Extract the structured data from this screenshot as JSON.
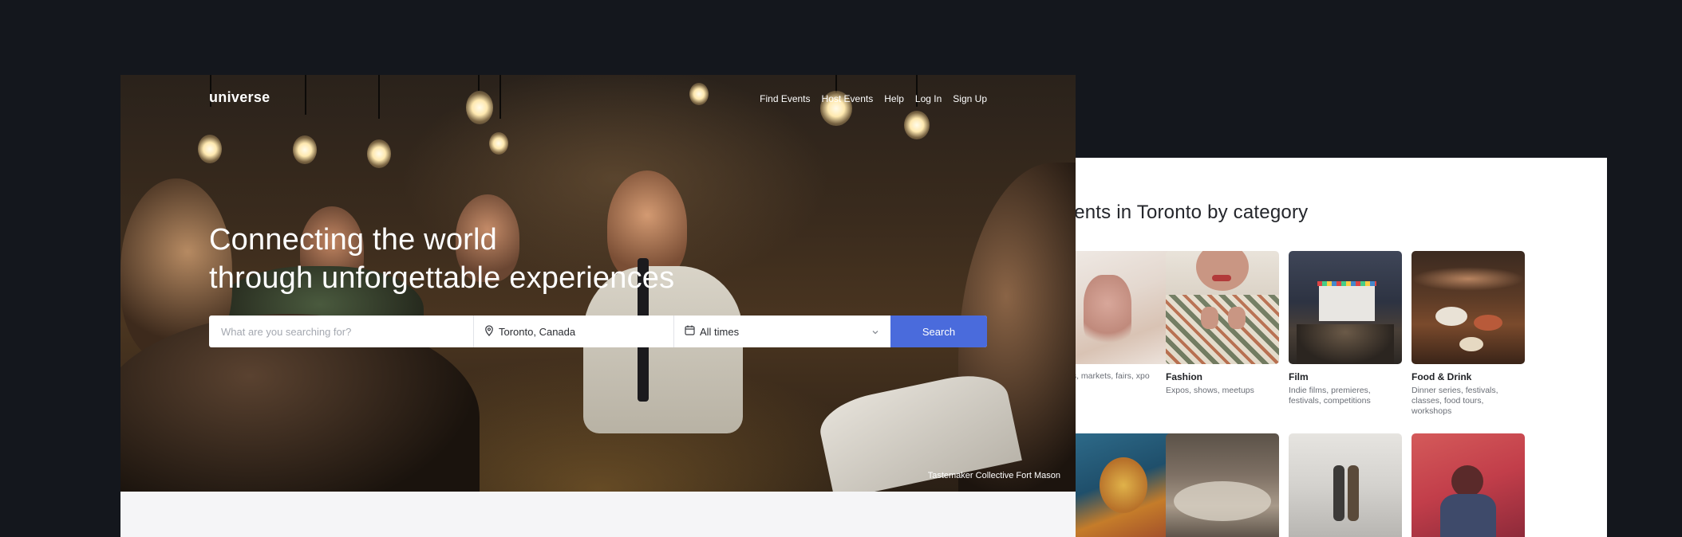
{
  "colors": {
    "page_bg": "#14171d",
    "accent": "#4a6bdc",
    "card_bg": "#ffffff"
  },
  "hero": {
    "logo": "universe",
    "nav": [
      "Find Events",
      "Host Events",
      "Help",
      "Log In",
      "Sign Up"
    ],
    "headline_line1": "Connecting the world",
    "headline_line2": "through unforgettable experiences",
    "search": {
      "placeholder": "What are you searching for?",
      "location_icon": "map-pin-icon",
      "location": "Toronto, Canada",
      "date_icon": "calendar-icon",
      "date": "All times",
      "button": "Search"
    },
    "photo_credit": "Tastemaker Collective Fort Mason"
  },
  "categories": {
    "title": "vents in Toronto by category",
    "items": [
      {
        "name": "",
        "desc": "ps, markets, fairs, xpo"
      },
      {
        "name": "Fashion",
        "desc": "Expos, shows, meetups"
      },
      {
        "name": "Film",
        "desc": "Indie films, premieres, festivals, competitions"
      },
      {
        "name": "Food & Drink",
        "desc": "Dinner series, festivals, classes, food tours, workshops"
      }
    ]
  }
}
